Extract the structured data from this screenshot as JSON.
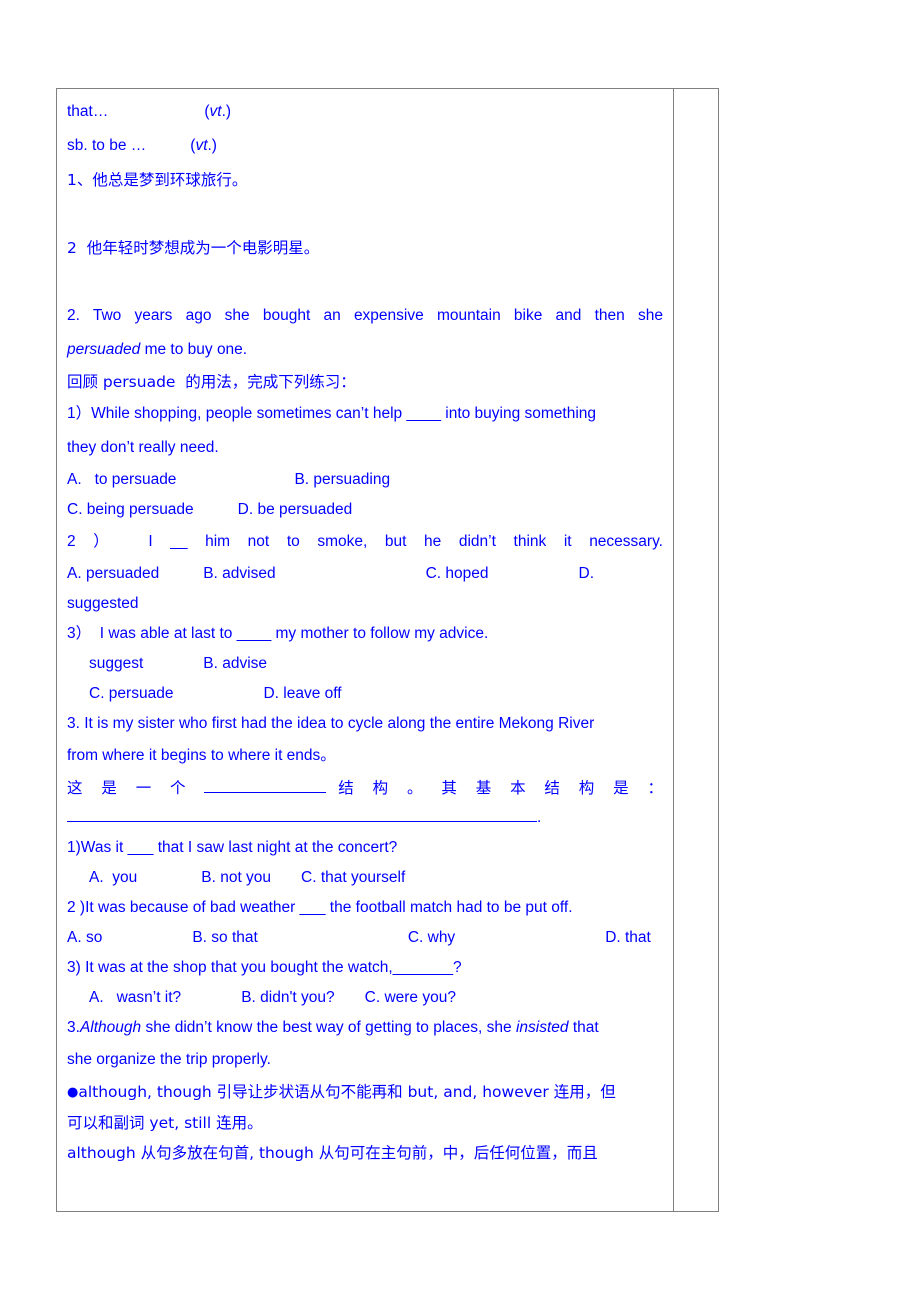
{
  "colors": {
    "text": "#0000FF",
    "border": "#808080",
    "background": "#ffffff"
  },
  "worksheet": {
    "lines": {
      "l01_a": "that…",
      "l01_b": "(vt.)",
      "l02_a": "sb. to be …",
      "l02_b": "(vt.)",
      "l03": "1、他总是梦到环球旅行。",
      "l04": "2  他年轻时梦想成为一个电影明星。",
      "l05": "2. Two years ago she bought an expensive mountain bike and then she",
      "l06_a": "persuaded",
      "l06_b": " me to buy one.",
      "l07": "回顾 persuade  的用法，完成下列练习：",
      "l08": "1）While shopping, people sometimes can’t help ____ into buying something",
      "l09": "they don’t really need.",
      "l10_a": "A.   to persuade",
      "l10_b": "B. persuading",
      "l11_a": "C. being persuade",
      "l11_b": "D. be persuaded",
      "l12": "2  ）    I  __  him  not  to  smoke,  but  he  didn’t  think  it  necessary.",
      "l13_a": "A. persuaded",
      "l13_b": "B. advised",
      "l13_c": "C. hoped",
      "l13_d": "D. suggested",
      "l14": "3）  I was able at last to ____ my mother to follow my advice.",
      "l15_a": "suggest",
      "l15_b": "B. advise",
      "l16_a": "C. persuade",
      "l16_b": "D. leave off",
      "l17": "3. It is my sister who first had the idea to cycle along the entire Mekong River",
      "l18": "from where it begins to where it ends。",
      "l19_a": "这 是 一 个 ",
      "l19_b": " 结 构 。 其 基 本 结 构 是 ：",
      "l20_suffix": ".",
      "l21": "1)Was it ___ that I saw last night at the concert?",
      "l22_a": "A.  you",
      "l22_b": "B. not you",
      "l22_c": "C. that yourself",
      "l23": "2 )It was because of bad weather ___ the football match had to be put off.",
      "l24_a": "A. so",
      "l24_b": "B. so that",
      "l24_c": "C. why",
      "l24_d": "D. that",
      "l25": "3) It was at the shop that you bought the watch,_______?",
      "l26_a": "A.   wasn’t it?",
      "l26_b": "B. didn't you?",
      "l26_c": "C. were you?",
      "l27_a": "3.",
      "l27_b": "Although",
      "l27_c": " she didn’t know the best way of getting to places, she ",
      "l27_d": "insisted",
      "l27_e": " that",
      "l28": "she organize the trip properly.",
      "l29_bullet": "●",
      "l29": "although, though 引导让步状语从句不能再和 but, and, however 连用，但",
      "l30": "可以和副词 yet, still 连用。",
      "l31": "although 从句多放在句首, though 从句可在主句前，中，后任何位置，而且"
    }
  }
}
